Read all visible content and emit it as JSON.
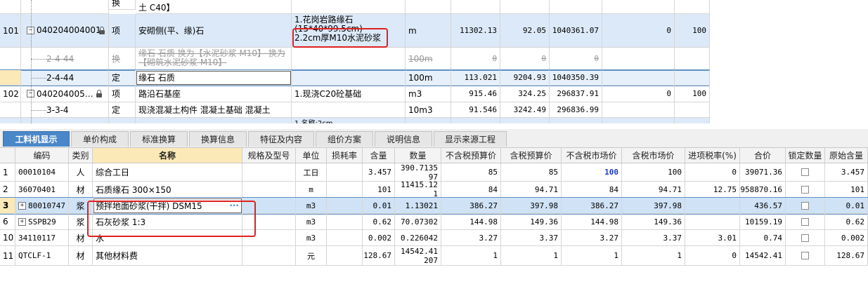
{
  "top_rows": [
    {
      "no": "",
      "code": "",
      "type": "换",
      "name": "土 C40】",
      "desc": "",
      "unit": "",
      "qty": "",
      "price": "",
      "total": "",
      "c1": "",
      "c2": ""
    },
    {
      "no": "101",
      "code": "040204004001",
      "type": "项",
      "name": "安砌侧(平、缘)石",
      "desc": "1.花岗岩路缘石\n(15*40*99.5cm)\n2.2cm厚M10水泥砂浆",
      "unit": "m",
      "qty": "11302.13",
      "price": "92.05",
      "total": "1040361.07",
      "c1": "0",
      "c2": "100"
    },
    {
      "no": "",
      "code": "2-4-44",
      "type": "换",
      "name": "缘石 石质 换为【水泥砂浆 M10】 换为【砌筑水泥砂浆 M10】",
      "desc": "",
      "unit": "100m",
      "qty": "0",
      "price": "0",
      "total": "0",
      "c1": "",
      "c2": ""
    },
    {
      "no": "",
      "code": "2-4-44",
      "type": "定",
      "name": "缘石 石质",
      "desc": "",
      "unit": "100m",
      "qty": "113.021",
      "price": "9204.93",
      "total": "1040350.39",
      "c1": "",
      "c2": ""
    },
    {
      "no": "102",
      "code": "040204005…",
      "type": "项",
      "name": "路沿石基座",
      "desc": "1.现浇C20砼基础",
      "unit": "m3",
      "qty": "915.46",
      "price": "324.25",
      "total": "296837.91",
      "c1": "0",
      "c2": "100"
    },
    {
      "no": "",
      "code": "3-3-4",
      "type": "定",
      "name": "现浇混凝土构件 混凝土基础 混凝土",
      "desc": "",
      "unit": "10m3",
      "qty": "91.546",
      "price": "3242.49",
      "total": "296836.99",
      "c1": "",
      "c2": ""
    },
    {
      "no": "",
      "code": "",
      "type": "",
      "name": "",
      "desc": "1.名称:2cm...",
      "unit": "",
      "qty": "",
      "price": "",
      "total": "",
      "c1": "",
      "c2": ""
    }
  ],
  "tabs": [
    "工料机显示",
    "单价构成",
    "标准换算",
    "换算信息",
    "特征及内容",
    "组价方案",
    "说明信息",
    "显示来源工程"
  ],
  "headers": [
    "编码",
    "类别",
    "名称",
    "规格及型号",
    "单位",
    "损耗率",
    "含量",
    "数量",
    "不含税预算价",
    "含税预算价",
    "不含税市场价",
    "含税市场价",
    "进项税率(%)",
    "合价",
    "锁定数量",
    "原始含量"
  ],
  "rows": [
    {
      "no": "1",
      "code": "00010104",
      "cat": "人",
      "name": "综合工日",
      "spec": "",
      "unit": "工日",
      "loss": "",
      "content": "3.457",
      "qty": "390.713597",
      "p1": "85",
      "p2": "85",
      "p3": "100",
      "p4": "100",
      "tax": "0",
      "total": "39071.36",
      "orig": "3.457",
      "expand": false
    },
    {
      "no": "2",
      "code": "36070401",
      "cat": "材",
      "name": "石质缘石 300×150",
      "spec": "",
      "unit": "m",
      "loss": "",
      "content": "101",
      "qty": "11415.121",
      "p1": "84",
      "p2": "94.71",
      "p3": "84",
      "p4": "94.71",
      "tax": "12.75",
      "total": "958870.16",
      "orig": "101",
      "expand": false
    },
    {
      "no": "3",
      "code": "80010747",
      "cat": "浆",
      "name": "预拌地面砂浆(干拌) DSM15",
      "spec": "",
      "unit": "m3",
      "loss": "",
      "content": "0.01",
      "qty": "1.13021",
      "p1": "386.27",
      "p2": "397.98",
      "p3": "386.27",
      "p4": "397.98",
      "tax": "",
      "total": "436.57",
      "orig": "0.01",
      "expand": true
    },
    {
      "no": "6",
      "code": "SSPB29",
      "cat": "浆",
      "name": "石灰砂浆 1:3",
      "spec": "",
      "unit": "m3",
      "loss": "",
      "content": "0.62",
      "qty": "70.07302",
      "p1": "144.98",
      "p2": "149.36",
      "p3": "144.98",
      "p4": "149.36",
      "tax": "",
      "total": "10159.19",
      "orig": "0.62",
      "expand": true
    },
    {
      "no": "10",
      "code": "34110117",
      "cat": "材",
      "name": "水",
      "spec": "",
      "unit": "m3",
      "loss": "",
      "content": "0.002",
      "qty": "0.226042",
      "p1": "3.27",
      "p2": "3.37",
      "p3": "3.27",
      "p4": "3.37",
      "tax": "3.01",
      "total": "0.74",
      "orig": "0.002",
      "expand": false
    },
    {
      "no": "11",
      "code": "QTCLF-1",
      "cat": "材",
      "name": "其他材料费",
      "spec": "",
      "unit": "元",
      "loss": "",
      "content": "128.67",
      "qty": "14542.41207",
      "p1": "1",
      "p2": "1",
      "p3": "1",
      "p4": "1",
      "tax": "0",
      "total": "14542.41",
      "orig": "128.67",
      "expand": false
    }
  ],
  "colors": {
    "accent": "#4a87c8",
    "highlight_red": "#e02020",
    "selected_row": "#cfe2f6",
    "name_header": "#fbe9b7"
  },
  "icons": [
    "lock-icon",
    "expand-icon",
    "ellipsis-icon",
    "checkbox-icon"
  ]
}
